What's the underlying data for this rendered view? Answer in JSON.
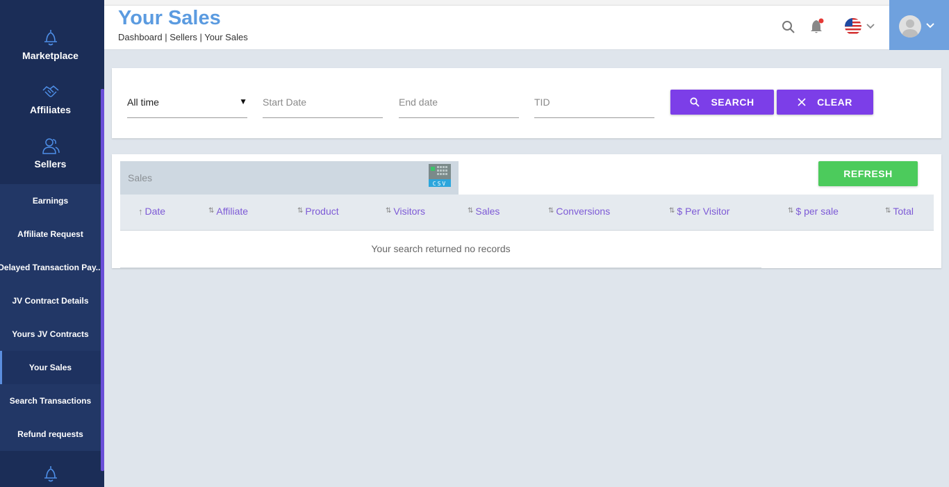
{
  "sidebar": {
    "main_items": [
      {
        "label": "Marketplace",
        "icon": "bell-icon"
      },
      {
        "label": "Affiliates",
        "icon": "handshake-icon"
      },
      {
        "label": "Sellers",
        "icon": "users-icon"
      }
    ],
    "sub_items": [
      {
        "label": "Earnings"
      },
      {
        "label": "Affiliate Request"
      },
      {
        "label": "Delayed Transaction Pay..."
      },
      {
        "label": "JV Contract Details"
      },
      {
        "label": "Yours JV Contracts"
      },
      {
        "label": "Your Sales",
        "active": true
      },
      {
        "label": "Search Transactions"
      },
      {
        "label": "Refund requests"
      }
    ],
    "bottom_icon": "bell-icon"
  },
  "header": {
    "title": "Your Sales",
    "breadcrumb": "Dashboard | Sellers | Your Sales",
    "icons": [
      "search-icon",
      "notification-bell-icon",
      "us-flag-icon",
      "user-avatar-icon"
    ]
  },
  "filters": {
    "period": "All time",
    "start_date_placeholder": "Start Date",
    "end_date_placeholder": "End date",
    "tid_placeholder": "TID",
    "search_label": "SEARCH",
    "clear_label": "CLEAR"
  },
  "table": {
    "tab_label": "Sales",
    "csv_label": "CSV",
    "refresh_label": "REFRESH",
    "columns": [
      "Date",
      "Affiliate",
      "Product",
      "Visitors",
      "Sales",
      "Conversions",
      "$ Per Visitor",
      "$ per sale",
      "Total"
    ],
    "empty_message": "Your search returned no records"
  },
  "colors": {
    "sidebar": "#1b2d57",
    "accent_purple": "#7c3ee8",
    "refresh_green": "#4ccb5c",
    "title_blue": "#5b9be0",
    "user_area": "#6fa1de"
  }
}
